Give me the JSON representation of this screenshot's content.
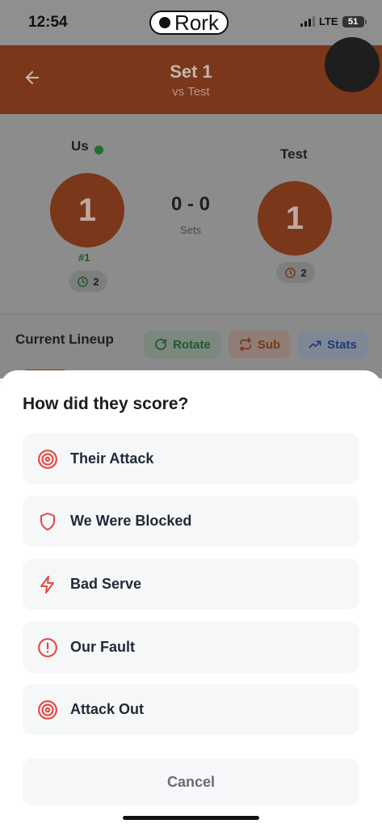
{
  "status_bar": {
    "time": "12:54",
    "app_badge": "Rork",
    "network": "LTE",
    "battery": "51"
  },
  "header": {
    "title": "Set 1",
    "subtitle": "vs Test"
  },
  "scoreboard": {
    "home": {
      "name": "Us",
      "score": "1",
      "rank": "#1",
      "timeouts": "2"
    },
    "away": {
      "name": "Test",
      "score": "1",
      "timeouts": "2"
    },
    "sets_score": "0 - 0",
    "sets_label": "Sets"
  },
  "lineup": {
    "title": "Current Lineup",
    "rotate_label": "Rotate",
    "sub_label": "Sub",
    "stats_label": "Stats"
  },
  "sheet": {
    "question": "How did they score?",
    "options": [
      {
        "label": "Their Attack",
        "icon": "target-icon"
      },
      {
        "label": "We Were Blocked",
        "icon": "shield-icon"
      },
      {
        "label": "Bad Serve",
        "icon": "lightning-icon"
      },
      {
        "label": "Our Fault",
        "icon": "alert-circle-icon"
      },
      {
        "label": "Attack Out",
        "icon": "target-icon"
      }
    ],
    "cancel_label": "Cancel"
  },
  "colors": {
    "accent": "#e8552f",
    "icon_red": "#e5483f",
    "sheet_bg": "#ffffff",
    "option_bg": "#f6f7f9"
  }
}
